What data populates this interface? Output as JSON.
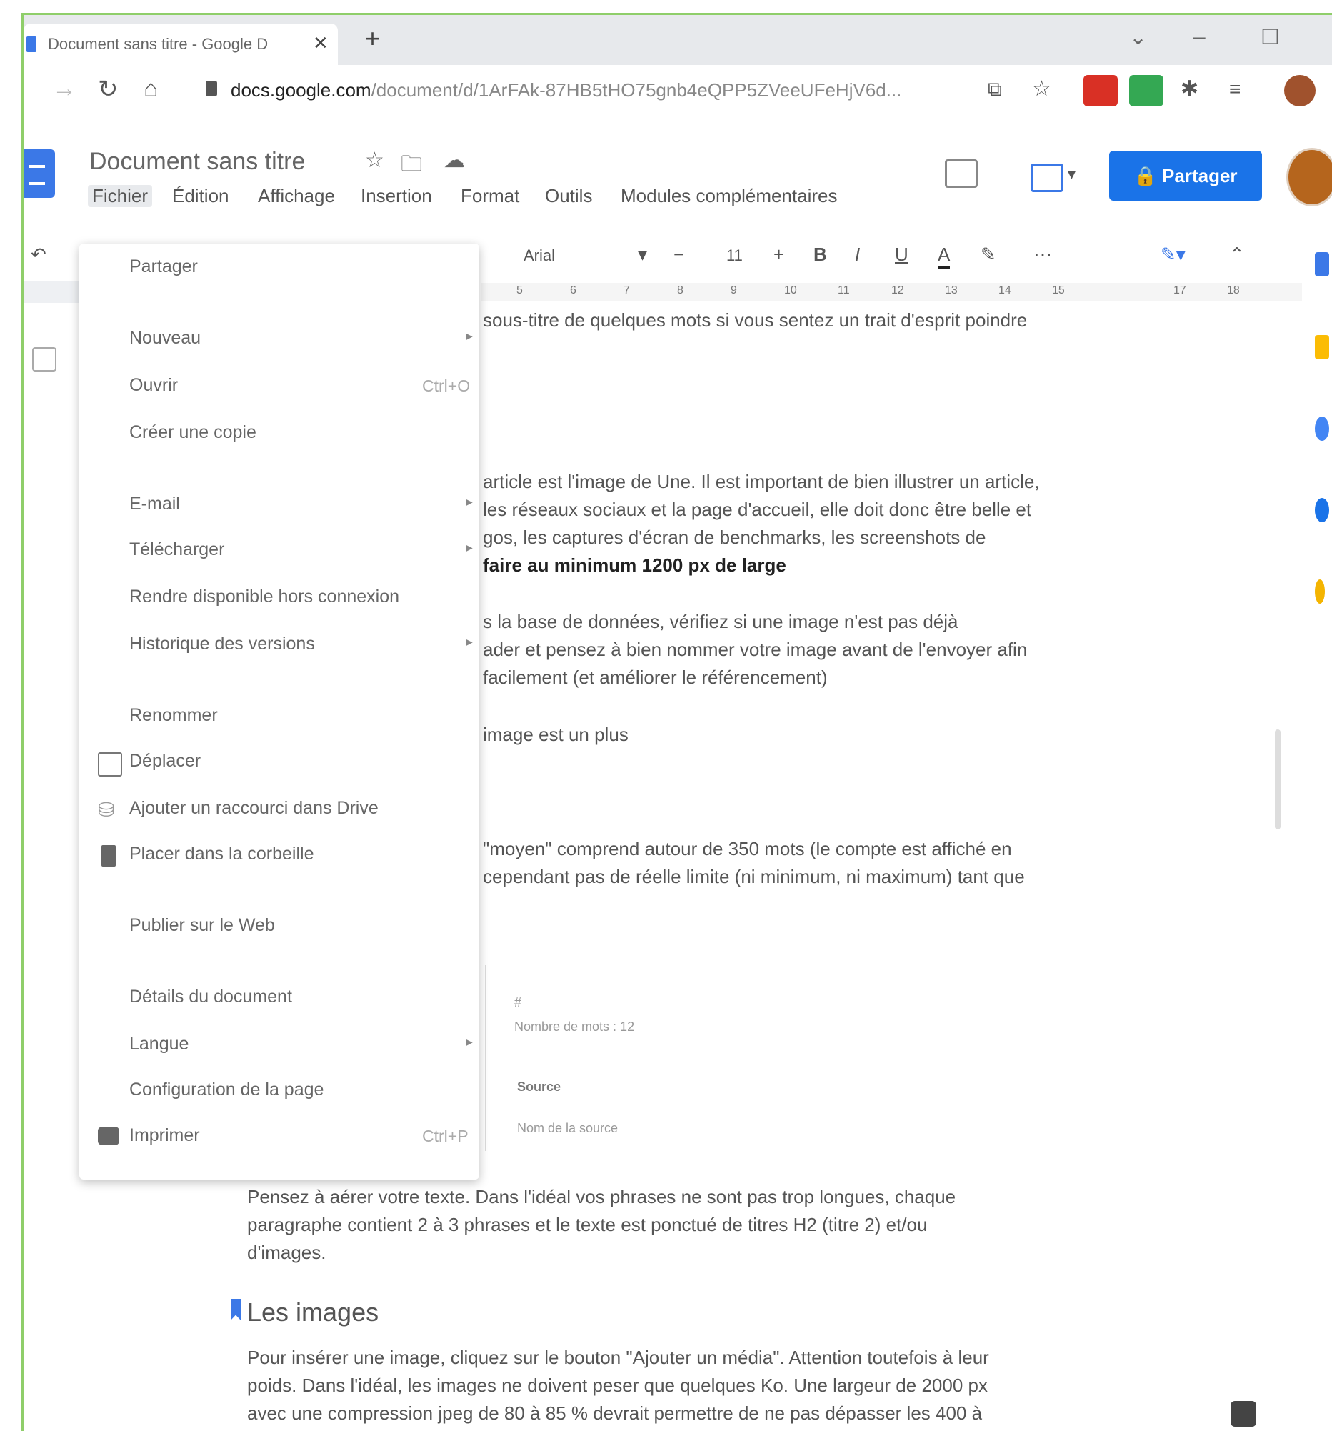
{
  "browser": {
    "tab_title": "Document sans titre - Google D",
    "tab_close": "✕",
    "new_tab": "+",
    "url_domain": "docs.google.com",
    "url_rest": "/document/d/1ArFAk-87HB5tHO75gnb4eQPP5ZVeeUFeHjV6d..."
  },
  "docs": {
    "title": "Document sans titre",
    "menus": [
      "Fichier",
      "Édition",
      "Affichage",
      "Insertion",
      "Format",
      "Outils",
      "Modules complémentaires"
    ],
    "share_label": "Partager",
    "font": "Arial",
    "font_size": "11",
    "ruler": [
      "5",
      "6",
      "7",
      "8",
      "9",
      "10",
      "11",
      "12",
      "13",
      "14",
      "15",
      "17",
      "18"
    ]
  },
  "file_menu": {
    "items": [
      {
        "label": "Partager"
      },
      {
        "label": "Nouveau",
        "submenu": true
      },
      {
        "label": "Ouvrir",
        "shortcut": "Ctrl+O"
      },
      {
        "label": "Créer une copie"
      },
      {
        "label": "E-mail",
        "submenu": true
      },
      {
        "label": "Télécharger",
        "submenu": true
      },
      {
        "label": "Rendre disponible hors connexion"
      },
      {
        "label": "Historique des versions",
        "submenu": true
      },
      {
        "label": "Renommer"
      },
      {
        "label": "Déplacer",
        "icon": "folder-move-icon"
      },
      {
        "label": "Ajouter un raccourci dans Drive",
        "icon": "drive-shortcut-icon"
      },
      {
        "label": "Placer dans la corbeille",
        "icon": "trash-icon"
      },
      {
        "label": "Publier sur le Web"
      },
      {
        "label": "Détails du document"
      },
      {
        "label": "Langue",
        "submenu": true
      },
      {
        "label": "Configuration de la page"
      },
      {
        "label": "Imprimer",
        "shortcut": "Ctrl+P",
        "icon": "print-icon"
      }
    ]
  },
  "peek": {
    "line1": "#",
    "line2": "Nombre de mots : 12",
    "line3": "Source",
    "line4": "Nom de la source"
  },
  "document": {
    "partial_lines": [
      "sous-titre de quelques mots si vous sentez un trait d'esprit poindre",
      "article est l'image de Une. Il est important de bien illustrer un article,",
      "les réseaux sociaux et la page d'accueil, elle doit donc être belle et",
      "gos, les captures d'écran de benchmarks, les screenshots de",
      "s la base de données, vérifiez si une image n'est pas déjà",
      "ader et pensez à bien nommer votre image avant de l'envoyer afin",
      "facilement (et améliorer le référencement)",
      "image est un plus",
      "\"moyen\" comprend autour de 350 mots (le compte est affiché en",
      "cependant pas de réelle limite (ni minimum, ni maximum) tant que"
    ],
    "bold_line": "faire au minimum 1200 px de large",
    "paragraph1": [
      "Pensez à aérer votre texte. Dans l'idéal vos phrases ne sont pas trop longues, chaque",
      "paragraphe contient 2 à 3 phrases et le texte est ponctué de titres H2 (titre 2) et/ou",
      "d'images."
    ],
    "heading": "Les images",
    "paragraph2": [
      "Pour insérer une image, cliquez sur le bouton \"Ajouter un média\". Attention toutefois à leur",
      "poids. Dans l'idéal, les images ne doivent peser que quelques Ko. Une largeur de 2000 px",
      "avec une compression jpeg de 80 à 85 % devrait permettre de ne pas dépasser les 400 à"
    ]
  }
}
